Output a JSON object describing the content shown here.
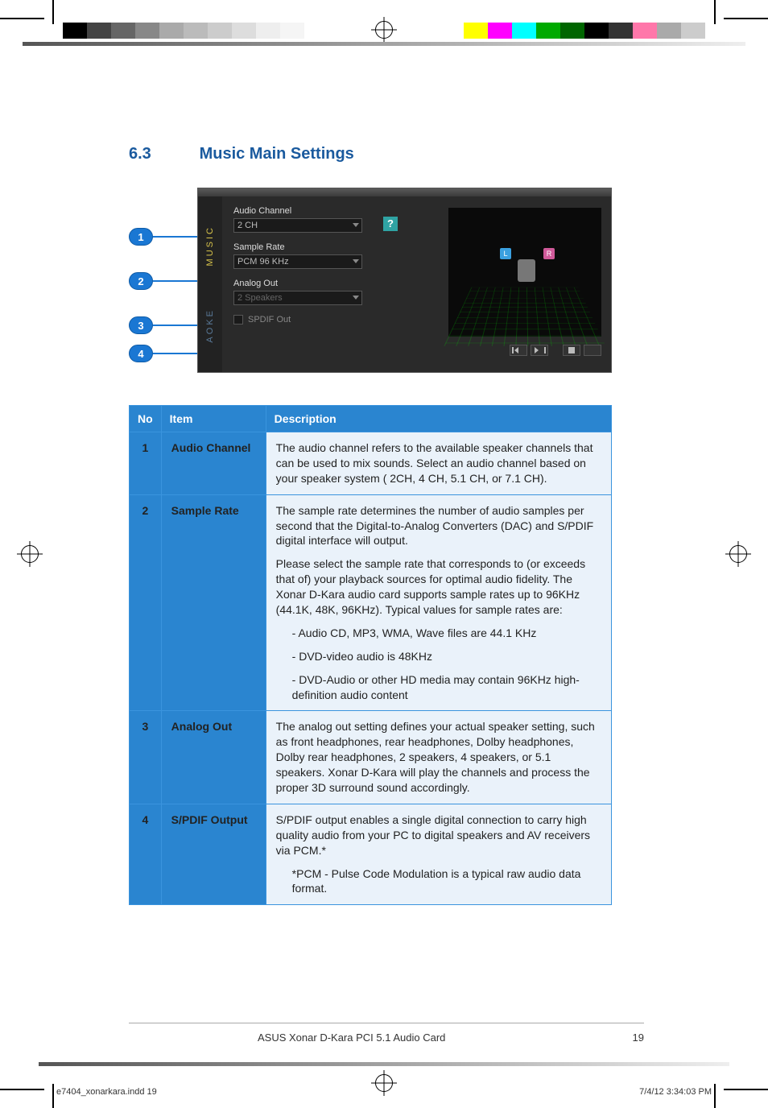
{
  "section_number": "6.3",
  "section_title": "Music Main Settings",
  "callouts": [
    "1",
    "2",
    "3",
    "4"
  ],
  "ui": {
    "side_labels": {
      "music": "MUSIC",
      "aoke": "AOKE"
    },
    "audio_channel": {
      "label": "Audio Channel",
      "value": "2 CH",
      "help": "?"
    },
    "sample_rate": {
      "label": "Sample Rate",
      "value": "PCM 96 KHz"
    },
    "analog_out": {
      "label": "Analog Out",
      "value": "2 Speakers"
    },
    "spdif_out_label": "SPDIF Out",
    "speakers": {
      "left": "L",
      "right": "R"
    }
  },
  "table": {
    "headers": {
      "no": "No",
      "item": "Item",
      "desc": "Description"
    },
    "rows": [
      {
        "no": "1",
        "item": "Audio Channel",
        "desc_paras": [
          "The audio channel refers to the available speaker channels that can be used to mix sounds. Select an audio channel based on your speaker system ( 2CH, 4 CH, 5.1 CH, or 7.1 CH)."
        ]
      },
      {
        "no": "2",
        "item": "Sample Rate",
        "desc_paras": [
          "The sample rate determines the number of audio samples per second that the Digital-to-Analog Converters (DAC) and S/PDIF digital interface will output.",
          "Please select the sample rate that corresponds to (or exceeds that of) your playback sources for optimal audio fidelity.  The Xonar D-Kara audio card supports sample rates up to 96KHz (44.1K, 48K, 96KHz). Typical values for sample rates are:"
        ],
        "bullets": [
          "- Audio CD, MP3, WMA, Wave files are 44.1 KHz",
          "- DVD-video audio is 48KHz",
          "- DVD-Audio or other HD media may contain 96KHz high-definition audio content"
        ]
      },
      {
        "no": "3",
        "item": "Analog Out",
        "desc_paras": [
          "The analog out setting defines your actual speaker setting, such as front headphones, rear headphones, Dolby headphones, Dolby rear headphones, 2 speakers, 4 speakers, or 5.1 speakers. Xonar D-Kara will play the channels and process the proper 3D surround sound accordingly."
        ]
      },
      {
        "no": "4",
        "item": "S/PDIF Output",
        "desc_paras": [
          "S/PDIF output enables a single digital connection to carry high quality audio from your PC to digital speakers and AV receivers via PCM.*"
        ],
        "notes": [
          "*PCM - Pulse Code Modulation is a typical raw audio data format."
        ]
      }
    ]
  },
  "footer": {
    "product": "ASUS Xonar D-Kara PCI 5.1 Audio Card",
    "page": "19"
  },
  "print": {
    "file": "e7404_xonarkara.indd   19",
    "timestamp": "7/4/12   3:34:03 PM"
  }
}
